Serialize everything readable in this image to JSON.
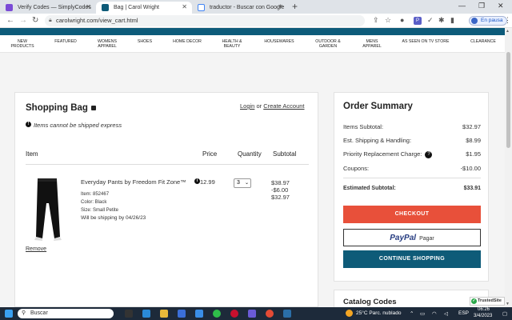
{
  "browser": {
    "tabs": [
      {
        "title": "Verify Codes — SimplyCodes",
        "color": "#7b4bd6"
      },
      {
        "title": "Bag | Carol Wright",
        "color": "#0e5b78"
      },
      {
        "title": "traductor - Buscar con Google",
        "color": "#4285f4"
      }
    ],
    "new_tab": "+",
    "url": "carolwright.com/view_cart.html",
    "profile_label": "En pausa",
    "window_controls": [
      "—",
      "❐",
      "✕"
    ]
  },
  "site": {
    "nav": [
      "NEW\nPRODUCTS",
      "FEATURED",
      "WOMENS\nAPPAREL",
      "SHOES",
      "HOME DECOR",
      "HEALTH &\nBEAUTY",
      "HOUSEWARES",
      "OUTDOOR &\nGARDEN",
      "MENS\nAPPAREL",
      "AS SEEN ON TV STORE",
      "CLEARANCE"
    ],
    "brand_color": "#0e5b78"
  },
  "bag": {
    "title": "Shopping Bag",
    "login": "Login",
    "or": "or",
    "create_account": "Create Account",
    "notice": "Items cannot be shipped express",
    "columns": {
      "item": "Item",
      "price": "Price",
      "quantity": "Quantity",
      "subtotal": "Subtotal"
    },
    "items": [
      {
        "name": "Everyday Pants by Freedom Fit Zone™",
        "price": "12.99",
        "item_no": "Item: 852467",
        "color": "Color: Black",
        "size": "Size: Small Petite",
        "ship": "Will be shipping by 04/26/23",
        "qty": "3",
        "subtotal": "$38.97",
        "discount": "-$6.00",
        "total": "$32.97",
        "remove": "Remove"
      }
    ]
  },
  "summary": {
    "title": "Order Summary",
    "rows": [
      {
        "label": "Items Subtotal:",
        "value": "$32.97"
      },
      {
        "label": "Est. Shipping & Handling:",
        "value": "$8.99"
      },
      {
        "label": "Priority Replacement Charge:",
        "value": "$1.95"
      },
      {
        "label": "Coupons:",
        "value": "-$10.00"
      }
    ],
    "estimated_label": "Estimated Subtotal:",
    "estimated_value": "$33.91",
    "checkout": "CHECKOUT",
    "paypal": "PayPal",
    "paypal_pagar": "Pagar",
    "continue": "CONTINUE SHOPPING",
    "catalog_title": "Catalog Codes",
    "trusted": "TrustedSite"
  },
  "taskbar": {
    "search_placeholder": "Buscar",
    "weather": "25°C  Parc. nublado",
    "lang": "ESP",
    "time": "06:26",
    "date": "3/4/2023"
  }
}
